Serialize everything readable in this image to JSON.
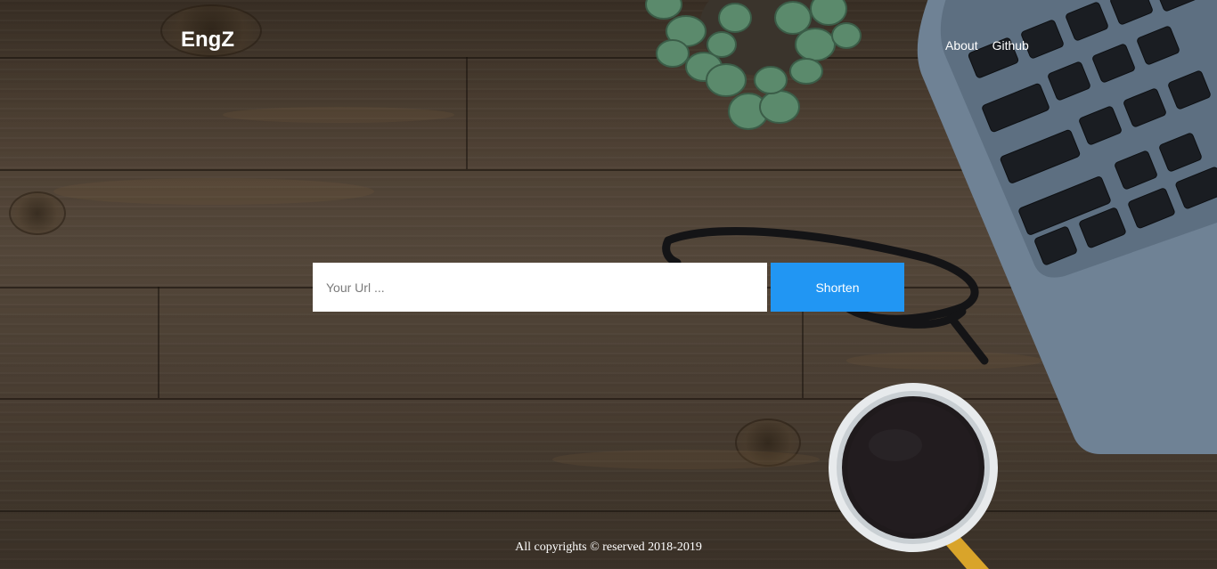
{
  "header": {
    "brand": "EngZ",
    "nav": [
      {
        "label": "About"
      },
      {
        "label": "Github"
      }
    ]
  },
  "form": {
    "url_placeholder": "Your Url ...",
    "url_value": "",
    "submit_label": "Shorten"
  },
  "footer": {
    "text": "All copyrights © reserved 2018-2019"
  },
  "colors": {
    "accent": "#2196f3",
    "text": "#ffffff",
    "background": "#4a3d31"
  },
  "icons": [
    "succulent-plant-decoration",
    "glasses-decoration",
    "laptop-decoration",
    "coffee-cup-decoration"
  ]
}
